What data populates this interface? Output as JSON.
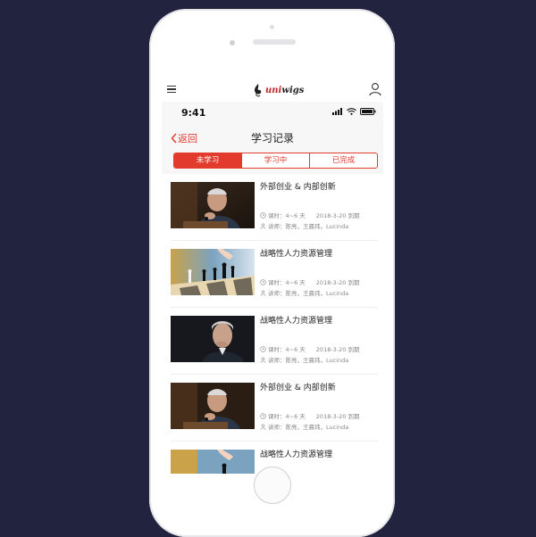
{
  "app": {
    "logo_text_uni": "uni",
    "logo_text_rest": "wigs"
  },
  "status": {
    "time": "9:41"
  },
  "nav": {
    "back_label": "返回",
    "title": "学习记录"
  },
  "tabs": [
    {
      "label": "未学习",
      "active": true
    },
    {
      "label": "学习中",
      "active": false
    },
    {
      "label": "已完成",
      "active": false
    }
  ],
  "courses": [
    {
      "title": "外部创业 & 内部创新",
      "hours": "课时：4~6 天",
      "date": "2018-3-20 到期",
      "lecturer": "讲师：陈亮，王晨玮，Lucinda",
      "thumb": "man-chess-hand"
    },
    {
      "title": "战略性人力资源管理",
      "hours": "课时：4~6 天",
      "date": "2018-3-20 到期",
      "lecturer": "讲师：陈亮，王晨玮，Lucinda",
      "thumb": "chess-board"
    },
    {
      "title": "战略性人力资源管理",
      "hours": "课时：4~6 天",
      "date": "2018-3-20 到期",
      "lecturer": "讲师：陈亮，王晨玮，Lucinda",
      "thumb": "thinking-man"
    },
    {
      "title": "外部创业 & 内部创新",
      "hours": "课时：4~6 天",
      "date": "2018-3-20 到期",
      "lecturer": "讲师：陈亮，王晨玮，Lucinda",
      "thumb": "man-chess-hand"
    },
    {
      "title": "战略性人力资源管理",
      "hours": "",
      "date": "",
      "lecturer": "",
      "thumb": "chess-board"
    }
  ],
  "colors": {
    "accent": "#e23b2e",
    "background": "#22243f"
  }
}
